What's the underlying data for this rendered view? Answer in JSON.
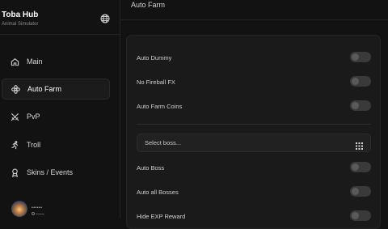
{
  "app": {
    "title": "Toba Hub",
    "subtitle": "Animal Simulator"
  },
  "sidebar": {
    "items": [
      {
        "label": "Main",
        "icon": "home-icon"
      },
      {
        "label": "Auto Farm",
        "icon": "flower-icon",
        "active": true
      },
      {
        "label": "PvP",
        "icon": "swords-icon"
      },
      {
        "label": "Troll",
        "icon": "running-person-icon"
      },
      {
        "label": "Skins / Events",
        "icon": "medal-icon"
      }
    ]
  },
  "profile": {
    "name": "••••••"
  },
  "main": {
    "title": "Auto Farm",
    "toggles_top": [
      {
        "label": "Auto Dummy",
        "on": false
      },
      {
        "label": "No Fireball FX",
        "on": false
      },
      {
        "label": "Auto Farm Coins",
        "on": false
      }
    ],
    "boss_select": {
      "placeholder": "Select boss...",
      "icon": "grid-icon"
    },
    "toggles_bottom": [
      {
        "label": "Auto Boss",
        "on": false
      },
      {
        "label": "Auto all Bosses",
        "on": false
      },
      {
        "label": "Hide EXP Reward",
        "on": false
      }
    ]
  },
  "colors": {
    "background": "#121212",
    "panel": "#1a1a1a",
    "toggle_off": "#3a3a3a",
    "text": "#cfcfcf"
  }
}
